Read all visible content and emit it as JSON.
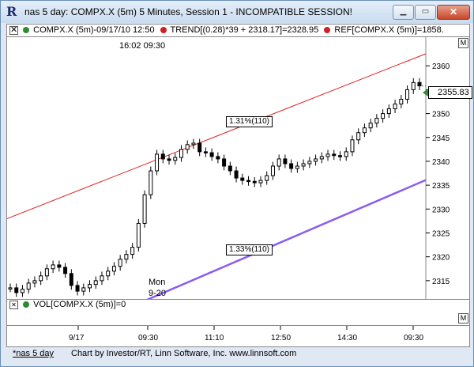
{
  "window": {
    "title": "nas 5 day: COMPX.X (5m) 5 Minutes, Session 1 - INCOMPATIBLE SESSION!",
    "minimize_icon": "minimize-icon",
    "maximize_icon": "maximize-icon",
    "close_icon": "close-icon"
  },
  "legend": {
    "x_glyph": "✕",
    "symbol_label": "COMPX.X (5m)-09/17/10 12:50",
    "trend_label": "TREND[(0.28)*39 + 2318.17]=2328.95",
    "ref_label": "REF[COMPX.X (5m)]=1858.",
    "colors": {
      "symbol_dot": "#2e8b2e",
      "trend_dot": "#cc2222",
      "ref_dot": "#cc2222"
    }
  },
  "chart": {
    "time_readout": "16:02  09:30",
    "last_price": "2355.83",
    "trend_upper_label": "1.31%(110)",
    "trend_lower_label": "1.33%(110)",
    "annotation_day": "Mon",
    "annotation_date": "9-20",
    "m_glyph": "M",
    "colors": {
      "upper_trend": "#e02020",
      "lower_trend": "#8a5cf0",
      "candle": "#000000"
    }
  },
  "chart_data": {
    "type": "candlestick",
    "title": "",
    "ylabel": "",
    "ylim": [
      2311,
      2366
    ],
    "y_ticks": [
      "2360",
      "2355",
      "2350",
      "2345",
      "2340",
      "2335",
      "2330",
      "2325",
      "2320",
      "2315"
    ],
    "x_tick_labels": [
      "9/17",
      "09:30",
      "11:10",
      "12:50",
      "14:30",
      "09:30"
    ],
    "series": [
      {
        "name": "COMPX.X (5m)",
        "values": [
          2313.5,
          2312.5,
          2313.2,
          2314.5,
          2315.0,
          2316.0,
          2317.5,
          2318.3,
          2317.8,
          2316.5,
          2314.0,
          2312.8,
          2313.5,
          2314.2,
          2315.0,
          2316.0,
          2317.0,
          2318.0,
          2319.5,
          2320.5,
          2322.0,
          2327.0,
          2333.0,
          2338.0,
          2341.5,
          2340.5,
          2340.2,
          2340.8,
          2342.5,
          2343.5,
          2343.8,
          2342.0,
          2341.8,
          2341.0,
          2340.5,
          2339.0,
          2338.0,
          2336.5,
          2336.0,
          2335.8,
          2335.5,
          2336.0,
          2337.0,
          2339.0,
          2340.5,
          2339.5,
          2338.5,
          2339.0,
          2339.5,
          2340.0,
          2340.5,
          2341.0,
          2341.5,
          2341.2,
          2341.0,
          2342.0,
          2344.5,
          2346.0,
          2347.0,
          2348.0,
          2349.0,
          2350.0,
          2351.0,
          2352.0,
          2353.0,
          2355.0,
          2356.5,
          2355.8
        ]
      }
    ],
    "trend_lines": [
      {
        "name": "TREND",
        "from": [
          0,
          2328.0
        ],
        "to": [
          67,
          2362.0
        ]
      },
      {
        "name": "TREND-lower",
        "from": [
          22,
          2310.5
        ],
        "to": [
          67,
          2335.5
        ]
      }
    ]
  },
  "volume": {
    "label": "VOL[COMPX.X (5m)]=0",
    "dot_color": "#2e8b2e"
  },
  "status": {
    "tab_label": "*nas 5 day",
    "credit": "Chart by Investor/RT, Linn Software, Inc. www.linnsoft.com"
  }
}
